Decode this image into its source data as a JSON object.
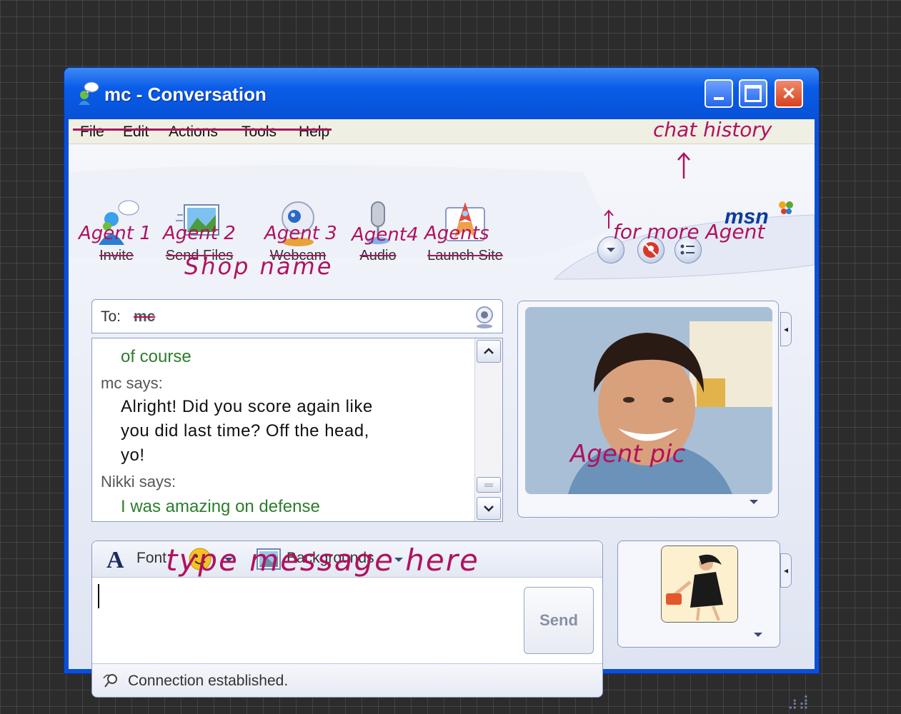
{
  "window": {
    "title": "mc - Conversation",
    "brand": "msn"
  },
  "menu": [
    "File",
    "Edit",
    "Actions",
    "Tools",
    "Help"
  ],
  "toolbar": [
    {
      "label": "Invite",
      "icon": "invite-icon",
      "annotation": "Agent 1"
    },
    {
      "label": "Send Files",
      "icon": "send-files-icon",
      "annotation": "Agent 2"
    },
    {
      "label": "Webcam",
      "icon": "webcam-icon",
      "annotation": "Agent 3"
    },
    {
      "label": "Audio",
      "icon": "audio-icon",
      "annotation": "Agent4"
    },
    {
      "label": "Launch Site",
      "icon": "launch-site-icon",
      "annotation": "Agents"
    }
  ],
  "annotations": {
    "chat_history": "chat history",
    "more_agents": "for more Agent",
    "shop_name": "Shop name",
    "agent_pic": "Agent pic",
    "type_message": "type message here"
  },
  "to": {
    "label": "To:",
    "name": "mc"
  },
  "conversation": [
    {
      "type": "msg",
      "text": "of course",
      "color": "green"
    },
    {
      "type": "says",
      "text": "mc says:"
    },
    {
      "type": "msg",
      "text": "Alright!  Did you score again like",
      "color": "black"
    },
    {
      "type": "msg",
      "text": "you did last time?  Off the head,",
      "color": "black"
    },
    {
      "type": "msg",
      "text": "yo!",
      "color": "black"
    },
    {
      "type": "says",
      "text": "Nikki says:"
    },
    {
      "type": "msg",
      "text": "I was amazing on defense",
      "color": "green"
    }
  ],
  "format_bar": {
    "font_label": "Font",
    "backgrounds_label": "Backgrounds"
  },
  "compose": {
    "value": "",
    "send_label": "Send"
  },
  "status": "Connection established.",
  "colors": {
    "annotation_ink": "#b0125f",
    "titlebar": "#0a5ce8",
    "green_text": "#2c7d2c"
  }
}
